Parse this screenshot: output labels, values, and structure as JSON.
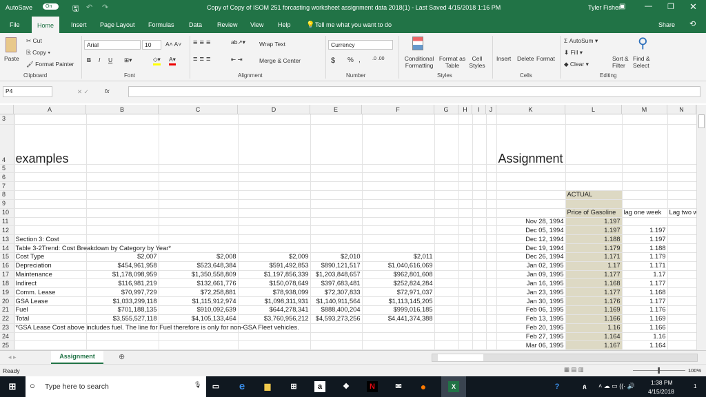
{
  "titlebar": {
    "autosave": "AutoSave",
    "autosave_state": "On",
    "title": "Copy of Copy of ISOM 251 forcasting worksheet assignment data 2018(1)  -  Last Saved 4/15/2018 1:16 PM",
    "user": "Tyler Fisher"
  },
  "tabs": [
    "File",
    "Home",
    "Insert",
    "Page Layout",
    "Formulas",
    "Data",
    "Review",
    "View",
    "Help"
  ],
  "tell_me": "Tell me what you want to do",
  "share": "Share",
  "ribbon": {
    "clipboard": {
      "paste": "Paste",
      "cut": "Cut",
      "copy": "Copy",
      "format_painter": "Format Painter",
      "label": "Clipboard"
    },
    "font": {
      "name": "Arial",
      "size": "10",
      "bold": "B",
      "italic": "I",
      "underline": "U",
      "label": "Font"
    },
    "alignment": {
      "wrap": "Wrap Text",
      "merge": "Merge & Center",
      "label": "Alignment"
    },
    "number": {
      "format": "Currency",
      "dollar": "$",
      "percent": "%",
      "comma": ",",
      "label": "Number"
    },
    "styles": {
      "conditional": "Conditional Formatting",
      "format_table": "Format as Table",
      "cell_styles": "Cell Styles",
      "label": "Styles"
    },
    "cells": {
      "insert": "Insert",
      "delete": "Delete",
      "format": "Format",
      "label": "Cells"
    },
    "editing": {
      "autosum": "AutoSum",
      "fill": "Fill",
      "clear": "Clear",
      "sort": "Sort & Filter",
      "find": "Find & Select",
      "label": "Editing"
    }
  },
  "formula_bar": {
    "name_box": "P4",
    "fx": "fx",
    "value": ""
  },
  "columns": [
    "A",
    "B",
    "C",
    "D",
    "E",
    "F",
    "G",
    "H",
    "I",
    "J",
    "K",
    "L",
    "M",
    "N"
  ],
  "rows": [
    {
      "n": "3",
      "c": [
        "",
        "",
        "",
        "",
        "",
        "",
        "",
        "",
        "",
        "",
        "",
        "",
        "",
        ""
      ]
    },
    {
      "n": "4",
      "c": [
        "examples",
        "",
        "",
        "",
        "",
        "",
        "",
        "",
        "",
        "",
        "Assignment",
        "",
        "",
        ""
      ]
    },
    {
      "n": "5",
      "c": [
        "",
        "",
        "",
        "",
        "",
        "",
        "",
        "",
        "",
        "",
        "",
        "",
        "",
        ""
      ]
    },
    {
      "n": "6",
      "c": [
        "",
        "",
        "",
        "",
        "",
        "",
        "",
        "",
        "",
        "",
        "",
        "",
        "",
        ""
      ]
    },
    {
      "n": "7",
      "c": [
        "",
        "",
        "",
        "",
        "",
        "",
        "",
        "",
        "",
        "",
        "",
        "",
        "",
        ""
      ]
    },
    {
      "n": "8",
      "c": [
        "",
        "",
        "",
        "",
        "",
        "",
        "",
        "",
        "",
        "",
        "",
        "ACTUAL",
        "",
        ""
      ]
    },
    {
      "n": "9",
      "c": [
        "",
        "",
        "",
        "",
        "",
        "",
        "",
        "",
        "",
        "",
        "",
        "",
        "",
        ""
      ]
    },
    {
      "n": "10",
      "c": [
        "",
        "",
        "",
        "",
        "",
        "",
        "",
        "",
        "",
        "",
        "",
        "Price of Gasoline",
        "lag one week",
        "Lag two w"
      ]
    },
    {
      "n": "11",
      "c": [
        "",
        "",
        "",
        "",
        "",
        "",
        "",
        "",
        "",
        "",
        "Nov 28, 1994",
        "1.197",
        "",
        ""
      ]
    },
    {
      "n": "12",
      "c": [
        "",
        "",
        "",
        "",
        "",
        "",
        "",
        "",
        "",
        "",
        "Dec 05, 1994",
        "1.197",
        "1.197",
        ""
      ]
    },
    {
      "n": "13",
      "c": [
        "Section 3: Cost",
        "",
        "",
        "",
        "",
        "",
        "",
        "",
        "",
        "",
        "Dec 12, 1994",
        "1.188",
        "1.197",
        ""
      ]
    },
    {
      "n": "14",
      "c": [
        "Table 3-2Trend: Cost Breakdown by Category by Year*",
        "",
        "",
        "",
        "",
        "",
        "",
        "",
        "",
        "",
        "Dec 19, 1994",
        "1.179",
        "1.188",
        ""
      ]
    },
    {
      "n": "15",
      "c": [
        "Cost Type",
        "$2,007",
        "$2,008",
        "$2,009",
        "$2,010",
        "$2,011",
        "",
        "",
        "",
        "",
        "Dec 26, 1994",
        "1.171",
        "1.179",
        ""
      ]
    },
    {
      "n": "16",
      "c": [
        "Depreciation",
        "$454,961,958",
        "$523,648,384",
        "$591,492,853",
        "$890,121,517",
        "$1,040,616,069",
        "",
        "",
        "",
        "",
        "Jan 02, 1995",
        "1.17",
        "1.171",
        ""
      ]
    },
    {
      "n": "17",
      "c": [
        "Maintenance",
        "$1,178,098,959",
        "$1,350,558,809",
        "$1,197,856,339",
        "$1,203,848,657",
        "$962,801,608",
        "",
        "",
        "",
        "",
        "Jan 09, 1995",
        "1.177",
        "1.17",
        ""
      ]
    },
    {
      "n": "18",
      "c": [
        "Indirect",
        "$116,981,219",
        "$132,661,776",
        "$150,078,649",
        "$397,683,481",
        "$252,824,284",
        "",
        "",
        "",
        "",
        "Jan 16, 1995",
        "1.168",
        "1.177",
        ""
      ]
    },
    {
      "n": "19",
      "c": [
        "Comm. Lease",
        "$70,997,729",
        "$72,258,881",
        "$78,938,099",
        "$72,307,833",
        "$72,971,037",
        "",
        "",
        "",
        "",
        "Jan 23, 1995",
        "1.177",
        "1.168",
        ""
      ]
    },
    {
      "n": "20",
      "c": [
        "GSA Lease",
        "$1,033,299,118",
        "$1,115,912,974",
        "$1,098,311,931",
        "$1,140,911,564",
        "$1,113,145,205",
        "",
        "",
        "",
        "",
        "Jan 30, 1995",
        "1.176",
        "1.177",
        ""
      ]
    },
    {
      "n": "21",
      "c": [
        "Fuel",
        "$701,188,135",
        "$910,092,639",
        "$644,278,341",
        "$888,400,204",
        "$999,016,185",
        "",
        "",
        "",
        "",
        "Feb 06, 1995",
        "1.169",
        "1.176",
        ""
      ]
    },
    {
      "n": "22",
      "c": [
        "Total",
        "$3,555,527,118",
        "$4,105,133,464",
        "$3,760,956,212",
        "$4,593,273,256",
        "$4,441,374,388",
        "",
        "",
        "",
        "",
        "Feb 13, 1995",
        "1.166",
        "1.169",
        ""
      ]
    },
    {
      "n": "23",
      "c": [
        "*GSA Lease Cost above includes fuel. The line for Fuel therefore is only for non-GSA Fleet vehicles.",
        "",
        "",
        "",
        "",
        "",
        "",
        "",
        "",
        "",
        "Feb 20, 1995",
        "1.16",
        "1.166",
        ""
      ]
    },
    {
      "n": "24",
      "c": [
        "",
        "",
        "",
        "",
        "",
        "",
        "",
        "",
        "",
        "",
        "Feb 27, 1995",
        "1.164",
        "1.16",
        ""
      ]
    },
    {
      "n": "25",
      "c": [
        "",
        "",
        "",
        "",
        "",
        "",
        "",
        "",
        "",
        "",
        "Mar 06, 1995",
        "1.167",
        "1.164",
        ""
      ]
    }
  ],
  "sheet_tab": "Assignment",
  "status": {
    "ready": "Ready",
    "zoom": "100%"
  },
  "taskbar": {
    "search": "Type here to search",
    "time": "1:38 PM",
    "date": "4/15/2018",
    "notifications": "1"
  },
  "colors": {
    "excel_green": "#217346",
    "highlight": "#ddd9c4"
  }
}
